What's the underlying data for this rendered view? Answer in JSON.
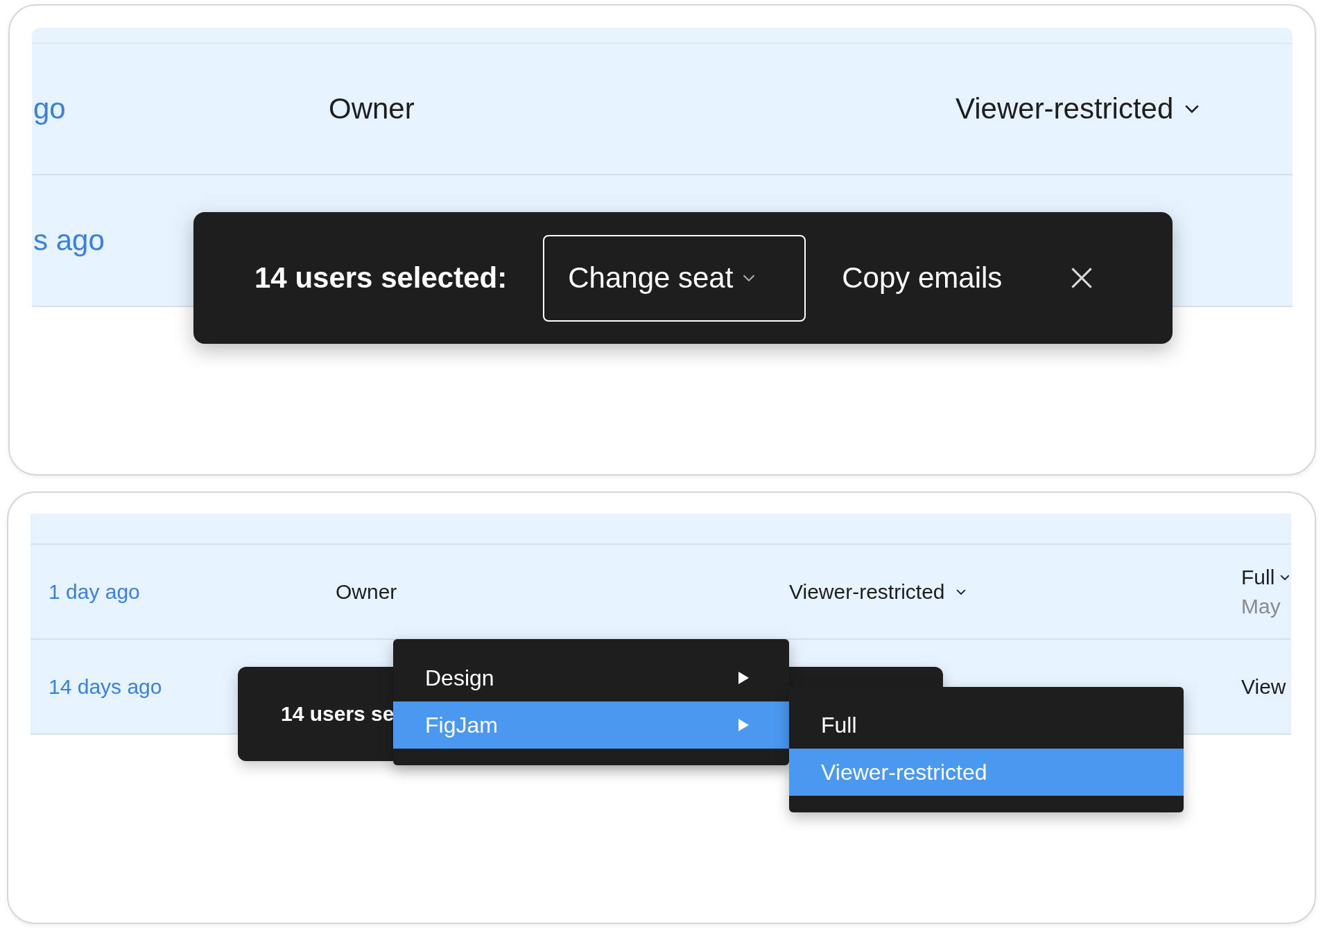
{
  "top_panel": {
    "rows": [
      {
        "last_active": "go",
        "role": "Owner",
        "seat": "Viewer-restricted",
        "seat_dropdown": true
      },
      {
        "last_active": "s ago"
      }
    ],
    "selection_bar": {
      "label": "14 users selected:",
      "buttons": [
        {
          "kind": "dropdown",
          "label": "Change seat"
        },
        {
          "kind": "text",
          "label": "Copy emails"
        },
        {
          "kind": "close"
        }
      ]
    }
  },
  "bottom_panel": {
    "rows": [
      {
        "last_active": "1 day ago",
        "role": "Owner",
        "seat": "Viewer-restricted",
        "seat_dropdown": true,
        "column_4": "Full",
        "column_4_dropdown": true,
        "column_4_sub": "May"
      },
      {
        "last_active": "14 days ago",
        "column_4": "View"
      }
    ],
    "selection_bar": {
      "label": "14 users se"
    },
    "menu": [
      {
        "label": "Design",
        "selected": false,
        "submenu": true
      },
      {
        "label": "FigJam",
        "selected": true,
        "submenu": true
      }
    ],
    "submenu": [
      {
        "label": "Full",
        "selected": false
      },
      {
        "label": "Viewer-restricted",
        "selected": true
      }
    ]
  }
}
